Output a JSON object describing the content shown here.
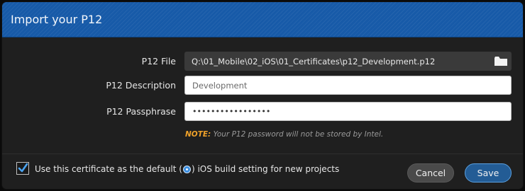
{
  "dialog": {
    "title": "Import your P12"
  },
  "form": {
    "p12_file": {
      "label": "P12 File",
      "value": "Q:\\01_Mobile\\02_iOS\\01_Certificates\\p12_Development.p12"
    },
    "p12_description": {
      "label": "P12 Description",
      "placeholder": "Development"
    },
    "p12_passphrase": {
      "label": "P12 Passphrase",
      "value": "•••••••••••••••••"
    }
  },
  "note": {
    "prefix": "NOTE:",
    "text": " Your P12 password will not be stored by Intel."
  },
  "default_setting": {
    "checked": true,
    "text_before": "Use this certificate as the default (",
    "text_after": ") iOS build setting for new projects"
  },
  "buttons": {
    "cancel": "Cancel",
    "save": "Save"
  },
  "colors": {
    "title_bar": "#175aa8",
    "note_accent": "#f0a22a",
    "save_border": "#5aa0e0",
    "ios_badge": "#3b8ee0"
  },
  "icons": {
    "folder": "folder-icon",
    "checkmark": "checkmark-icon",
    "ios_badge": "ios-badge-icon"
  }
}
